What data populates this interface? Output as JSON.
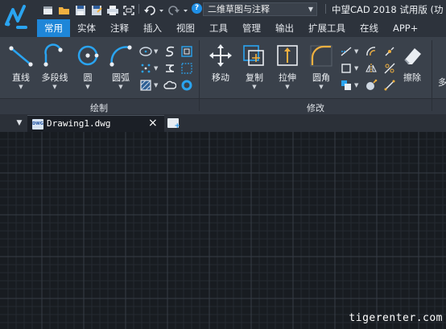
{
  "app": {
    "title": "中望CAD 2018 试用版 (功",
    "workspace": "二维草图与注释"
  },
  "quick_access": [
    "new-icon",
    "open-icon",
    "save-icon",
    "save-as-icon",
    "print-icon",
    "zoom-extents-icon",
    "undo-icon",
    "redo-icon",
    "help-icon"
  ],
  "help_glyph": "?",
  "tabs": [
    {
      "label": "常用"
    },
    {
      "label": "实体"
    },
    {
      "label": "注释"
    },
    {
      "label": "插入"
    },
    {
      "label": "视图"
    },
    {
      "label": "工具"
    },
    {
      "label": "管理"
    },
    {
      "label": "输出"
    },
    {
      "label": "扩展工具"
    },
    {
      "label": "在线"
    },
    {
      "label": "APP+"
    }
  ],
  "draw_panel": {
    "label": "绘制",
    "line": "直线",
    "polyline": "多段线",
    "circle": "圆",
    "arc": "圆弧"
  },
  "modify_panel": {
    "label": "修改",
    "move": "移动",
    "copy": "复制",
    "stretch": "拉伸",
    "fillet": "圆角",
    "erase": "擦除",
    "more": "多"
  },
  "document": {
    "menu_glyph": "▼",
    "tab_name": "Drawing1.dwg",
    "dwg_badge": "DWG",
    "close_glyph": "×"
  },
  "watermark": "tigerenter.com",
  "colors": {
    "accent": "#1e86d8",
    "icon_blue": "#2aa4f0",
    "icon_orange": "#f0b040",
    "canvas": "#181c21",
    "ribbon": "#3a414b"
  }
}
